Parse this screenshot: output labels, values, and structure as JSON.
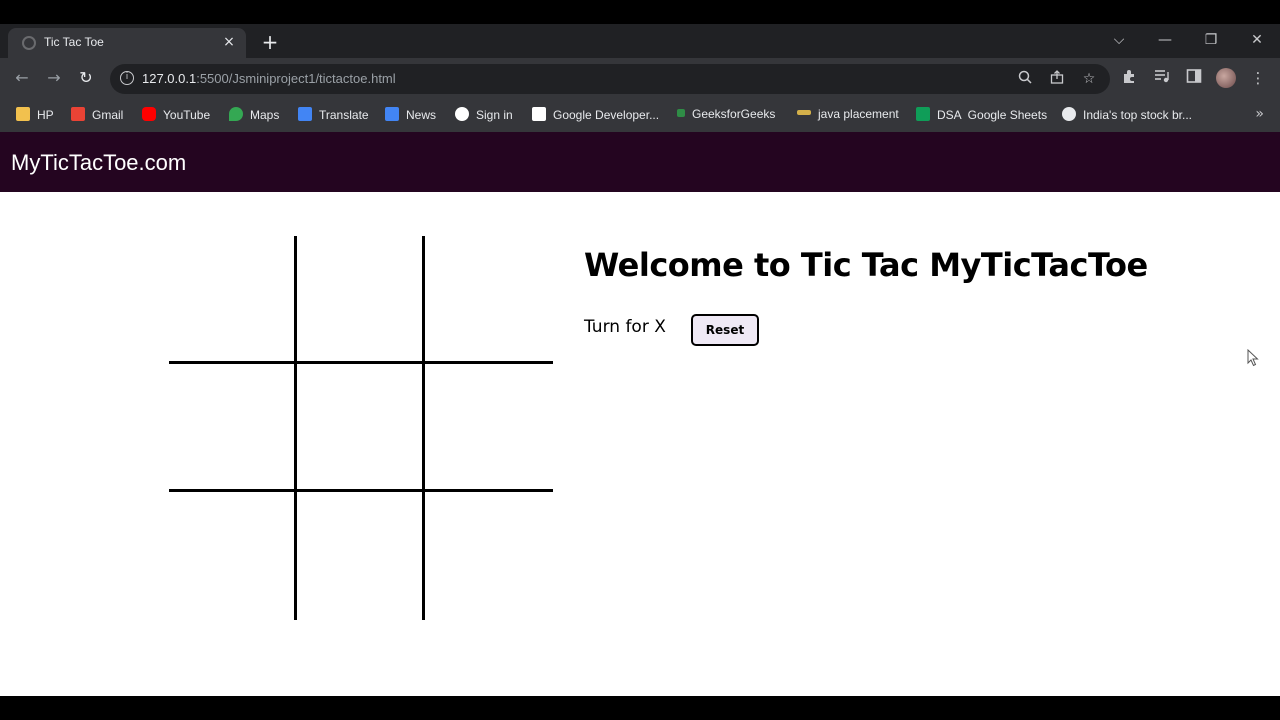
{
  "browser": {
    "tab_title": "Tic Tac Toe",
    "tab_close": "×",
    "new_tab": "+",
    "url_host": "127.0.0.1",
    "url_path": ":5500/Jsminiproject1/tictactoe.html",
    "window_controls": {
      "dropdown": "⌵",
      "minimize": "—",
      "restore": "❐",
      "close": "✕"
    },
    "bookmarks": [
      {
        "label": "HP",
        "icon": "folder-icon",
        "color": "#f2c14e"
      },
      {
        "label": "Gmail",
        "icon": "gmail-icon",
        "color": "#ea4335"
      },
      {
        "label": "YouTube",
        "icon": "youtube-icon",
        "color": "#ff0000"
      },
      {
        "label": "Maps",
        "icon": "maps-icon",
        "color": "#34a853"
      },
      {
        "label": "Translate",
        "icon": "translate-icon",
        "color": "#4285f4"
      },
      {
        "label": "News",
        "icon": "news-icon",
        "color": "#4285f4"
      },
      {
        "label": "Sign in",
        "icon": "google-icon",
        "color": "#ffffff"
      },
      {
        "label": "Google Developer...",
        "icon": "google-developers-icon",
        "color": "#ffffff"
      },
      {
        "label": "GeeksforGeeks",
        "icon": "geeksforgeeks-icon",
        "color": "#2f8d46"
      },
      {
        "label": "java placement",
        "icon": "java-placement-icon",
        "color": "#d4b04a"
      },
      {
        "label": "DSA  Google Sheets",
        "icon": "sheets-icon",
        "color": "#0f9d58"
      },
      {
        "label": "India's top stock br...",
        "icon": "globe-icon",
        "color": "#e8eaed"
      }
    ],
    "bookmarks_more": "»"
  },
  "site": {
    "logo": "MyTicTacToe.com"
  },
  "game": {
    "heading": "Welcome to Tic Tac MyTicTacToe",
    "turn_text": "Turn for X",
    "reset_label": "Reset",
    "cells": [
      "",
      "",
      "",
      "",
      "",
      "",
      "",
      "",
      ""
    ]
  }
}
